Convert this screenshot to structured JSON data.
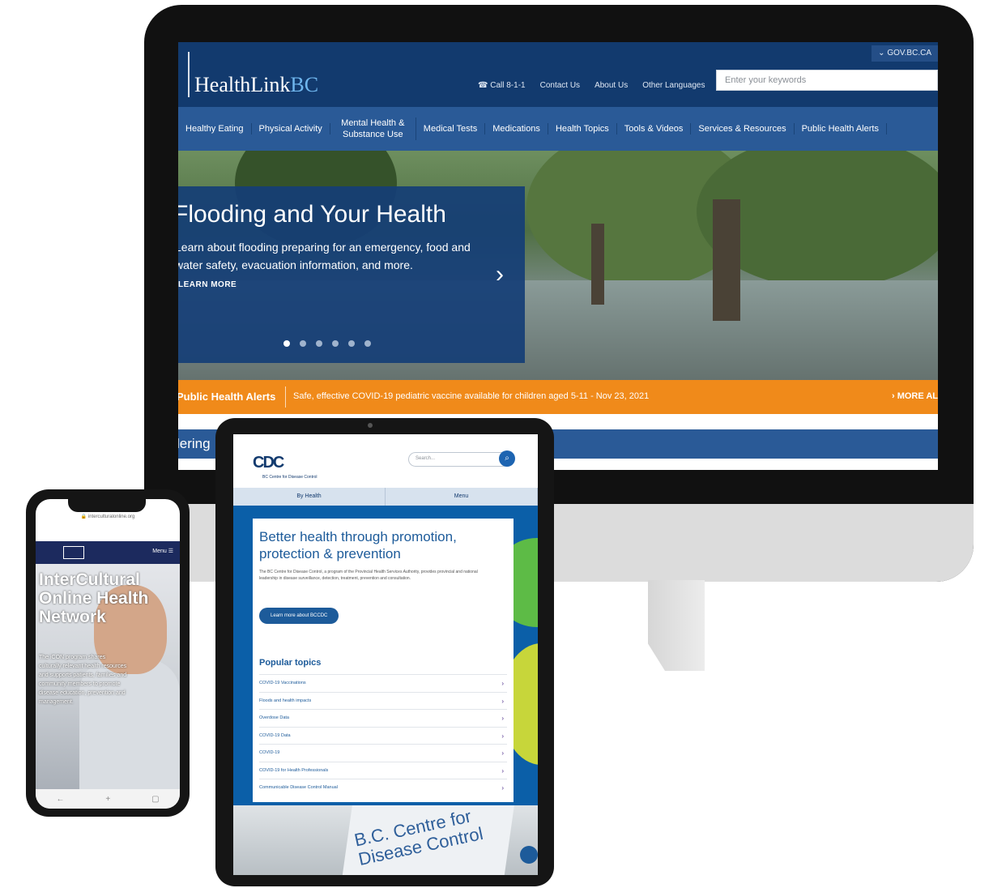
{
  "desktop": {
    "gov_link": "GOV.BC.CA",
    "logo_health": "HealthLink",
    "logo_bc": "BC",
    "utils": [
      "Call 8-1-1",
      "Contact Us",
      "About Us",
      "Other Languages"
    ],
    "search_placeholder": "Enter your keywords",
    "nav": [
      "Healthy Eating",
      "Physical Activity",
      "Mental Health & Substance Use",
      "Medical Tests",
      "Medications",
      "Health Topics",
      "Tools & Videos",
      "Services & Resources",
      "Public Health Alerts"
    ],
    "hero_title": "Flooding and Your Health",
    "hero_desc": "Learn about flooding preparing for an emergency, food and water safety, evacuation information, and more.",
    "hero_cta": "LEARN MORE",
    "alert_label": "Public Health Alerts",
    "alert_text": "Safe, effective COVID-19 pediatric vaccine available for children aged 5-11 - Nov 23, 2021",
    "alert_more": "MORE AL",
    "strip_text": "lering"
  },
  "tablet": {
    "logo": "CDC",
    "tagline": "BC Centre for Disease Control",
    "search_placeholder": "Search...",
    "tabs": [
      "By Health",
      "Menu"
    ],
    "headline": "Better health through promotion, protection & prevention",
    "body": "The BC Centre for Disease Control, a program of the Provincial Health Services Authority, provides provincial and national leadership in disease surveillance, detection, treatment, prevention and consultation.",
    "cta": "Learn more about BCCDC",
    "popular_title": "Popular topics",
    "topics": [
      "COVID-19 Vaccinations",
      "Floods and health impacts",
      "Overdose Data",
      "COVID-19 Data",
      "COVID-19",
      "COVID-19 for Health Professionals",
      "Communicable Disease Control Manual"
    ],
    "sign_text": "B.C. Centre for Disease Control"
  },
  "phone": {
    "url": "interculturalonline.org",
    "menu": "Menu",
    "hero_title": "InterCultural Online Health Network",
    "hero_desc": "The iCON program shares culturally relevant health resources and supports patients, families and community members to promote disease education, prevention and management."
  },
  "colors": {
    "hl_navy": "#123a6e",
    "hl_nav": "#2a5a97",
    "alert_orange": "#f08a1a",
    "cdc_blue": "#1d5b9a"
  }
}
